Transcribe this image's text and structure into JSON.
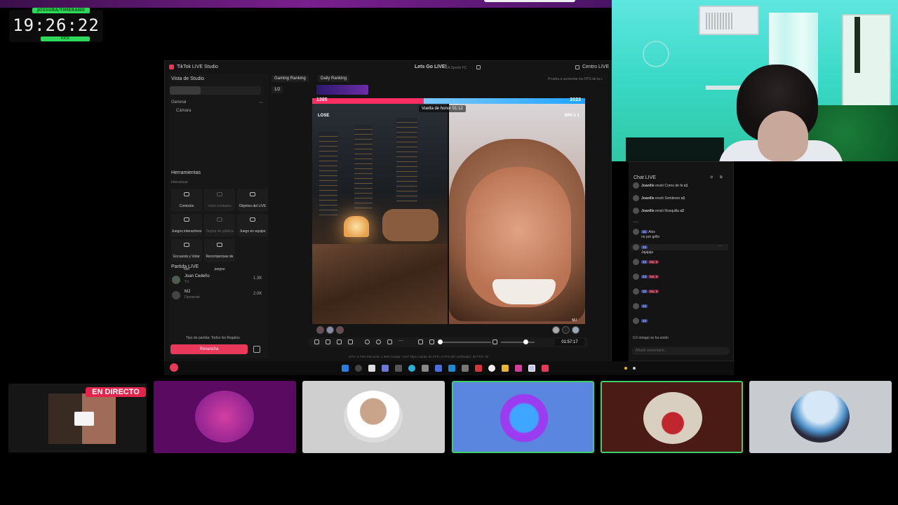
{
  "clock": {
    "top_label": "JOSSURA/TIMERANO",
    "time": "19:26:22",
    "bottom_label": "KICK"
  },
  "studio": {
    "app_title": "TikTok LIVE Studio",
    "stream_title": "Lets Go LIVE!",
    "stream_game": "EA Sports FC",
    "centro": "Centro LIVE",
    "tip": "Prueba a aumentar los FPS de la c",
    "view_label": "Vista de Studio",
    "general": "General",
    "camera": "Cámara",
    "tools_title": "Herramientas",
    "interaction": "Interactuar",
    "tools": [
      {
        "label": "Comisión",
        "disabled": false
      },
      {
        "label": "Votos invitados",
        "disabled": true
      },
      {
        "label": "Objetivo del LIVE",
        "disabled": false
      },
      {
        "label": "Juegos interactivos",
        "disabled": false
      },
      {
        "label": "Tarjeta de pública",
        "disabled": true
      },
      {
        "label": "Juego en equipo",
        "disabled": false
      },
      {
        "label": "Encuesta y Votar con",
        "disabled": false
      },
      {
        "label": "Recompensas de juegos",
        "disabled": false
      }
    ],
    "match_title": "Partida LIVE",
    "players": [
      {
        "name": "Joan Cedeño",
        "sub": "Tú",
        "score": "1.3K"
      },
      {
        "name": "MJ",
        "sub": "Oponente",
        "score": "2.0K"
      }
    ],
    "match_type": "Tipo de partida: Todos los Regalos",
    "rematch": "Revancha",
    "ranking_gaming": "Gaming Ranking",
    "ranking_daily": "Daily Ranking",
    "ranking_count": "1/2"
  },
  "battle": {
    "score_left": "1395",
    "score_right": "2023",
    "victory_lap": "Vuelta de honor 01:12",
    "left_result": "LOSE",
    "right_result": "WIN x 1",
    "opponent_tag": "MJ",
    "left_score_fraction": 0.41
  },
  "controls": {
    "timer": "01:57:17",
    "stats": "CPU: 4.79%   Memoria: 1.38%   Cargar: 2427 kbps   Caídas de FPS: 0   FPS del codificador: 30   FPS: 30"
  },
  "chat": {
    "title": "Chat LIVE",
    "gifts": [
      {
        "user": "Joanille",
        "text": "envió Corno de fe",
        "count": "x1"
      },
      {
        "user": "Joanille",
        "text": "envió Sombrero",
        "count": "x1"
      },
      {
        "user": "Joanille",
        "text": "envió Rosquilla",
        "count": "x2"
      }
    ],
    "dots": "......",
    "messages": [
      {
        "lvl": "31",
        "user": "Alos",
        "text": "no por grillo"
      },
      {
        "lvl": "33",
        "user": "",
        "text": "Jajajaja"
      },
      {
        "lvl": "33",
        "tag": "No. 3",
        "text": ""
      },
      {
        "lvl": "33",
        "tag": "No. 3",
        "text": ""
      },
      {
        "lvl": "33",
        "tag": "No. 3",
        "text": ""
      },
      {
        "lvl": "33",
        "tag": "",
        "text": ""
      },
      {
        "lvl": "33",
        "tag": "",
        "text": ""
      }
    ],
    "joined": "0.0 mirago   se ha unido",
    "input_placeholder": "Añadir comentario..."
  },
  "thumbnails": {
    "live_badge": "EN DIRECTO"
  },
  "colors": {
    "accent_pink": "#e8395b",
    "score_red": "#ff2d63",
    "score_blue": "#1fa4ff",
    "selected_tile": "#3fd06a"
  }
}
